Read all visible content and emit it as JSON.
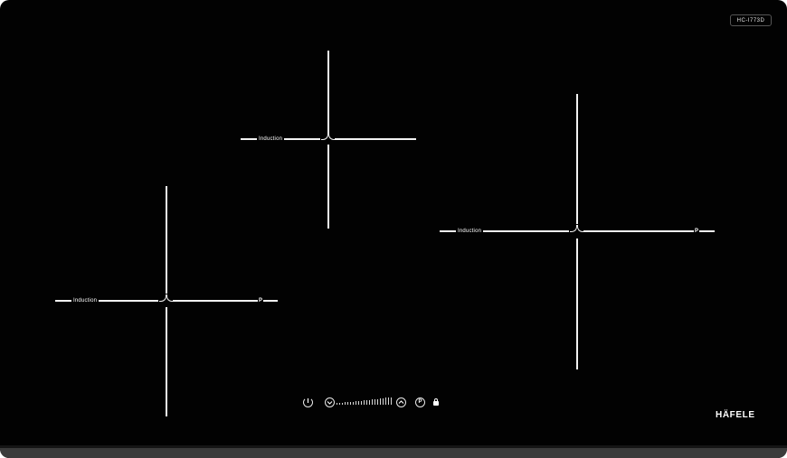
{
  "brand": {
    "logo_text": "HÄFELE",
    "model_label": "HC-I773D"
  },
  "zones": [
    {
      "id": "top-center",
      "label": "Induction",
      "has_boost": false
    },
    {
      "id": "bottom-left",
      "label": "Induction",
      "has_boost": true,
      "boost_label": "P"
    },
    {
      "id": "right",
      "label": "Induction",
      "has_boost": true,
      "boost_label": "P"
    }
  ],
  "controls": {
    "power_symbol": "power-icon",
    "minus_symbol": "chevron-down-icon",
    "plus_symbol": "chevron-up-icon",
    "pause_label": "P",
    "lock_symbol": "lock-icon",
    "slider_symbol": "power-level-slider"
  },
  "colors": {
    "glass": "#020202",
    "markings": "#f2f2f2",
    "frame": "#3b3b3b"
  }
}
